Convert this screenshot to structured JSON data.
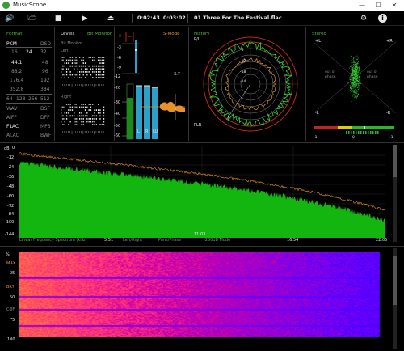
{
  "app": {
    "title": "MusicScope"
  },
  "toolbar": {
    "elapsed": "0:02:43",
    "separator": "/",
    "duration": "0:03:02",
    "track": "01 Three For The Festival.flac"
  },
  "format": {
    "title": "Format",
    "pcm_label": "PCM",
    "dsd_label": "DSD",
    "bitdepths": [
      "16",
      "24",
      "32"
    ],
    "rates_left": [
      "44.1",
      "88.2",
      "176.4",
      "352.8"
    ],
    "rates_right": [
      "48",
      "96",
      "192",
      "384"
    ],
    "dsd_rates": [
      "64",
      "128",
      "256",
      "512"
    ],
    "containers_left": [
      "WAV",
      "AIFF",
      "FLAC",
      "ALAC"
    ],
    "containers_right": [
      "DSF",
      "DFF",
      "MP3",
      "BWF"
    ]
  },
  "levels": {
    "title": "Levels",
    "bit_monitor_tab": "Bit Monitor",
    "bit_monitor_label": "Bit Monitor",
    "left": "Left",
    "right": "Right",
    "scale": [
      "0",
      "-3",
      "-6",
      "-9",
      "-12",
      "-20",
      "-30",
      "-40",
      "-50",
      "-60"
    ],
    "peak_value": "3.7",
    "s_mode": "S-Mode",
    "lr_labels": [
      "L",
      "R",
      "LU"
    ]
  },
  "history": {
    "title": "History",
    "pl_label": "P/L",
    "plr_label": "PLR",
    "ring_scale": [
      "-6",
      "-12",
      "-18",
      "-24"
    ]
  },
  "stereo": {
    "title": "Stereo",
    "pos_l": "+L",
    "pos_r": "+R",
    "neg_l": "-L",
    "neg_r": "-R",
    "out_of_phase": "out of phase",
    "corr_min": "-1",
    "corr_mid": "0",
    "corr_max": "+1"
  },
  "spectrum": {
    "db_label": "dB",
    "y_ticks": [
      "0",
      "-12",
      "-24",
      "-36",
      "-48",
      "-60",
      "-72",
      "-84",
      "-100",
      "-144"
    ],
    "x_ticks": [
      "5.51",
      "11.03",
      "16.54",
      "22.05"
    ],
    "mode_linear": "Linear Frequency Spectrum (kHz)",
    "mode_leftright": "Left/Right",
    "mode_panphase": "Pans/Phase",
    "mode_200db": "-200dB Mode"
  },
  "spectrogram": {
    "y_labels": [
      "%",
      "MAX",
      "25",
      "BRY",
      "50",
      "CQF",
      "75",
      "100"
    ]
  },
  "colors": {
    "accent_green": "#5ab54a",
    "spectrum_green": "#12b60e",
    "orange": "#e5922a",
    "level_blue": "#2ba0c8",
    "red_ring": "#c0261c"
  }
}
